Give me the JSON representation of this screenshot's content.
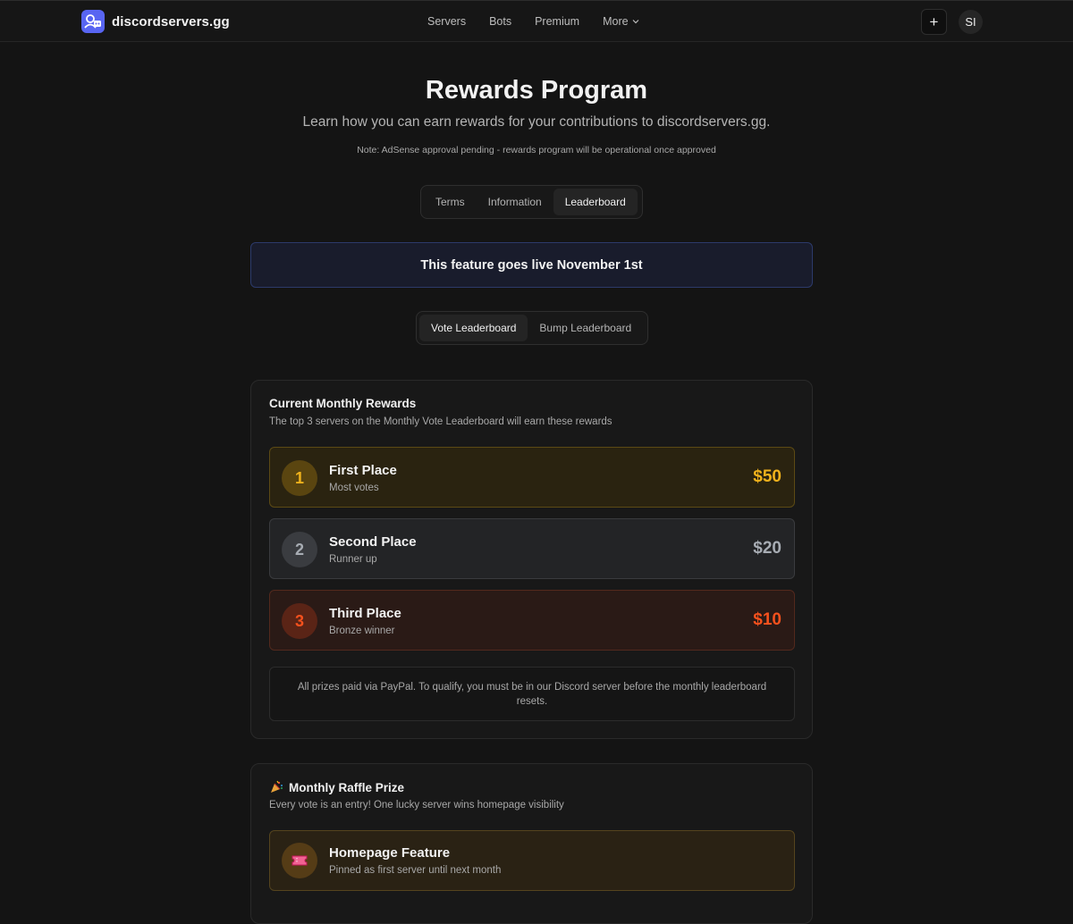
{
  "header": {
    "brand": "discordservers.gg",
    "nav": [
      "Servers",
      "Bots",
      "Premium",
      "More"
    ],
    "add_label": "+",
    "avatar_initials": "SI"
  },
  "hero": {
    "title": "Rewards Program",
    "subtitle": "Learn how you can earn rewards for your contributions to discordservers.gg.",
    "note": "Note: AdSense approval pending - rewards program will be operational once approved"
  },
  "main_tabs": [
    {
      "label": "Terms",
      "active": false
    },
    {
      "label": "Information",
      "active": false
    },
    {
      "label": "Leaderboard",
      "active": true
    }
  ],
  "banner": "This feature goes live November 1st",
  "leaderboard_tabs": [
    {
      "label": "Vote Leaderboard",
      "active": true
    },
    {
      "label": "Bump Leaderboard",
      "active": false
    }
  ],
  "monthly_rewards": {
    "title": "Current Monthly Rewards",
    "subtitle": "The top 3 servers on the Monthly Vote Leaderboard will earn these rewards",
    "prizes": [
      {
        "rank": "1",
        "name": "First Place",
        "desc": "Most votes",
        "amount": "$50"
      },
      {
        "rank": "2",
        "name": "Second Place",
        "desc": "Runner up",
        "amount": "$20"
      },
      {
        "rank": "3",
        "name": "Third Place",
        "desc": "Bronze winner",
        "amount": "$10"
      }
    ],
    "note": "All prizes paid via PayPal. To qualify, you must be in our Discord server before the monthly leaderboard resets."
  },
  "raffle": {
    "title": "Monthly Raffle Prize",
    "subtitle": "Every vote is an entry! One lucky server wins homepage visibility",
    "prize_name": "Homepage Feature",
    "prize_desc": "Pinned as first server until next month"
  },
  "colors": {
    "accent": "#5865f2",
    "gold": "#f0b21c",
    "silver": "#a7acb3",
    "bronze": "#f6511d"
  }
}
